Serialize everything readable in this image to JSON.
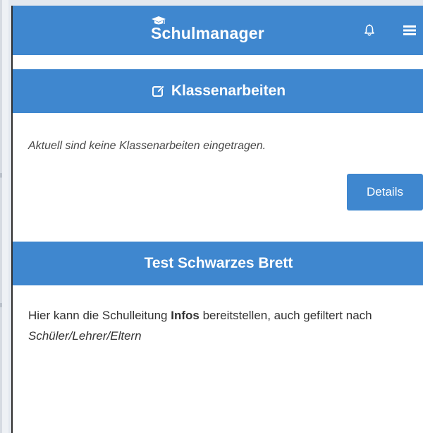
{
  "header": {
    "brand": "Schulmanager",
    "icons": {
      "logo": "graduation-cap-icon",
      "notifications": "bell-icon",
      "menu": "hamburger-menu-icon"
    }
  },
  "exams": {
    "title": "Klassenarbeiten",
    "title_icon": "edit-icon",
    "empty_message": "Aktuell sind keine Klassenarbeiten eingetragen.",
    "details_label": "Details"
  },
  "board": {
    "title": "Test Schwarzes Brett",
    "text_before": "Hier kann die Schulleitung ",
    "text_bold": "Infos",
    "text_middle": " bereitstellen, auch gefiltert nach ",
    "text_italic": "Schüler/Lehrer/Eltern"
  },
  "colors": {
    "primary": "#3f87cf",
    "background": "#ffffff",
    "text": "#333333"
  }
}
